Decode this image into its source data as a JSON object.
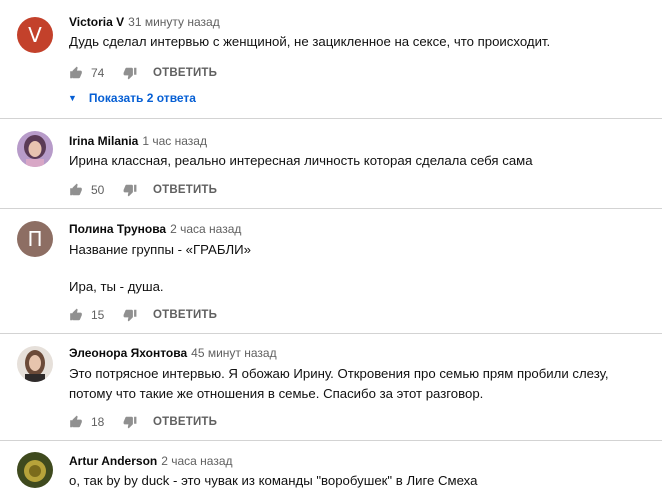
{
  "comments": [
    {
      "author": "Victoria V",
      "time": "31 минуту назад",
      "avatar_letter": "V",
      "lines": [
        "Дудь сделал интервью с женщиной, не зацикленное на сексе, что происходит."
      ],
      "likes": "74",
      "reply_label": "ОТВЕТИТЬ",
      "show_replies": "Показать 2 ответа"
    },
    {
      "author": "Irina Milania",
      "time": "1 час назад",
      "lines": [
        "Ирина классная, реально интересная личность которая сделала себя сама"
      ],
      "likes": "50",
      "reply_label": "ОТВЕТИТЬ"
    },
    {
      "author": "Полина Трунова",
      "time": "2 часа назад",
      "avatar_letter": "П",
      "lines": [
        "Название группы - «ГРАБЛИ»",
        "Ира, ты - душа."
      ],
      "likes": "15",
      "reply_label": "ОТВЕТИТЬ"
    },
    {
      "author": "Элеонора Яхонтова",
      "time": "45 минут назад",
      "lines": [
        "Это потрясное интервью. Я обожаю Ирину. Откровения про семью прям пробили слезу,",
        "потому что такие же отношения в семье. Спасибо за этот разговор."
      ],
      "likes": "18",
      "reply_label": "ОТВЕТИТЬ"
    },
    {
      "author": "Artur Anderson",
      "time": "2 часа назад",
      "lines": [
        "о, так by by duck - это чувак из команды \"воробушек\" в Лиге Смеха"
      ]
    }
  ],
  "colors": {
    "link": "#065fd4",
    "muted": "#606060",
    "divider": "#d3d3d3"
  },
  "icons": [
    "thumb-up-icon",
    "thumb-down-icon",
    "chevron-down-icon"
  ]
}
